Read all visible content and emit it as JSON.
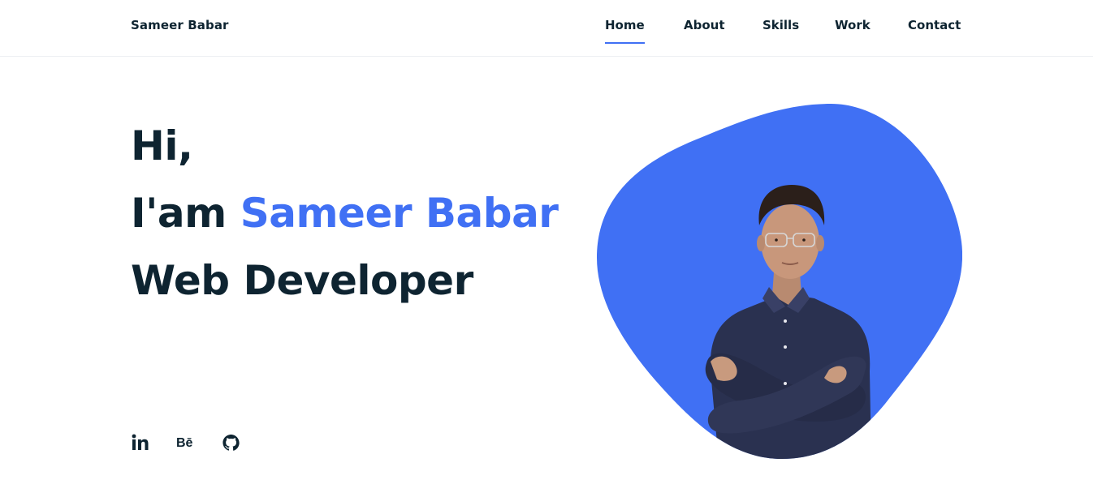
{
  "header": {
    "brand": "Sameer Babar",
    "nav": [
      {
        "label": "Home",
        "active": true
      },
      {
        "label": "About",
        "active": false
      },
      {
        "label": "Skills",
        "active": false
      },
      {
        "label": "Work",
        "active": false
      },
      {
        "label": "Contact",
        "active": false
      }
    ]
  },
  "hero": {
    "line1": "Hi,",
    "line2_prefix": "I'am",
    "line2_name": "Sameer Babar",
    "line3": "Web Developer"
  },
  "socials": [
    {
      "name": "linkedin",
      "icon": "linkedin-icon"
    },
    {
      "name": "behance",
      "icon": "behance-icon",
      "text": "Bē"
    },
    {
      "name": "github",
      "icon": "github-icon"
    }
  ],
  "colors": {
    "accent": "#4070f4",
    "text": "#0e2431",
    "background": "#ffffff"
  }
}
